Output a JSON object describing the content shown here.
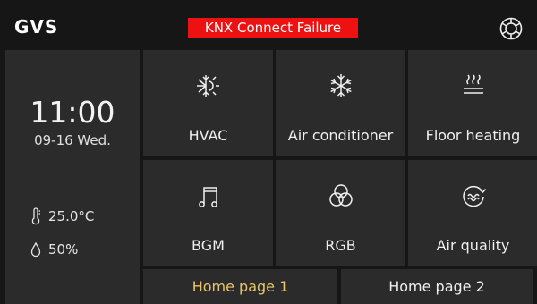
{
  "header": {
    "logo": "GVS",
    "alert": "KNX Connect Failure",
    "settings_icon": "settings-gear-icon"
  },
  "status": {
    "time": "11:00",
    "date": "09-16  Wed.",
    "temperature": "25.0°C",
    "humidity": "50%"
  },
  "tiles": [
    {
      "label": "HVAC",
      "icon": "hvac-icon"
    },
    {
      "label": "Air conditioner",
      "icon": "snowflake-icon"
    },
    {
      "label": "Floor heating",
      "icon": "floor-heating-icon"
    },
    {
      "label": "BGM",
      "icon": "music-note-icon"
    },
    {
      "label": "RGB",
      "icon": "rgb-circles-icon"
    },
    {
      "label": "Air quality",
      "icon": "air-quality-icon"
    }
  ],
  "tabs": [
    {
      "label": "Home page 1",
      "active": true
    },
    {
      "label": "Home page 2",
      "active": false
    }
  ],
  "colors": {
    "background": "#161616",
    "tile": "#2b2b2b",
    "alert": "#ee1111",
    "active_tab": "#e8c56a"
  }
}
